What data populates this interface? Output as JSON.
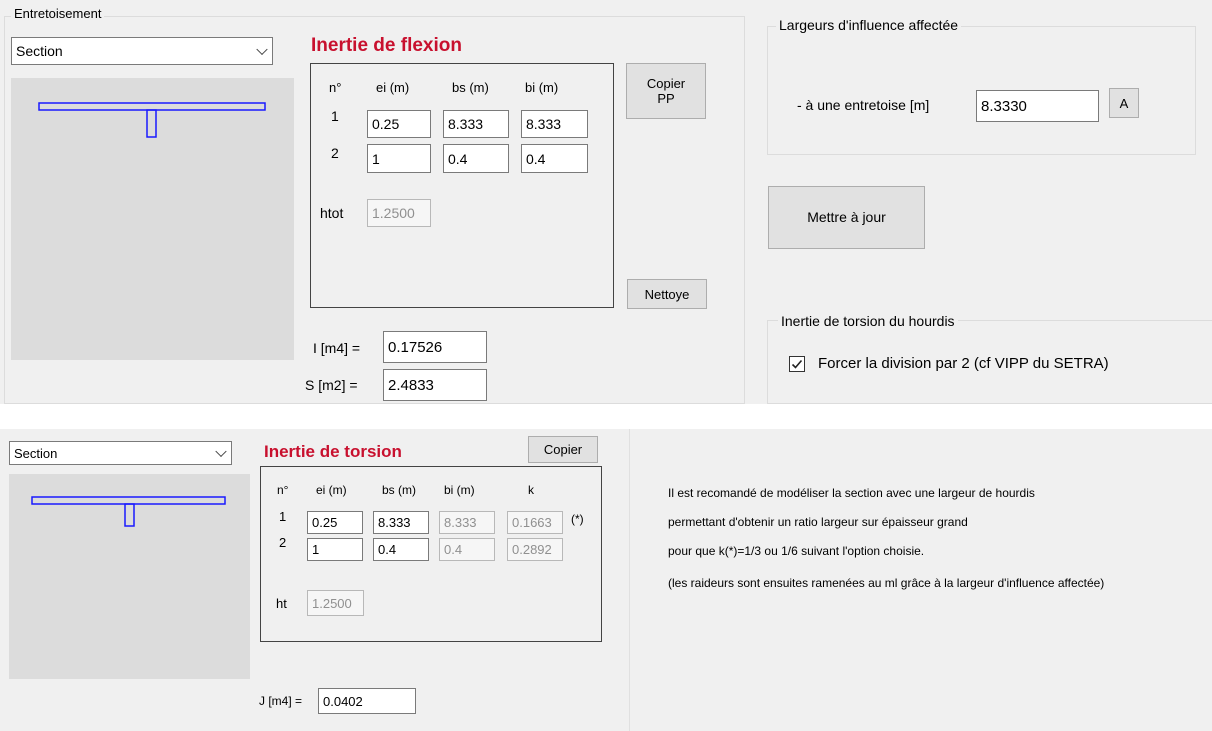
{
  "top": {
    "group_label": "Entretoisement",
    "section_select": {
      "value": "Section"
    },
    "flexion": {
      "title": "Inertie de flexion",
      "headers": [
        "n°",
        "ei (m)",
        "bs (m)",
        "bi (m)"
      ],
      "rows": [
        {
          "n": "1",
          "ei": "0.25",
          "bs": "8.333",
          "bi": "8.333"
        },
        {
          "n": "2",
          "ei": "1",
          "bs": "0.4",
          "bi": "0.4"
        }
      ],
      "htot_label": "htot",
      "htot_value": "1.2500",
      "copy_button": "Copier\nPP",
      "clean_button": "Nettoye",
      "inertia_label": "I [m4] =",
      "inertia_value": "0.17526",
      "area_label": "S [m2] =",
      "area_value": "2.4833"
    },
    "influence": {
      "group_label": "Largeurs d'influence affectée",
      "field_label": "- à une entretoise [m]",
      "field_value": "8.3330",
      "a_button": "A"
    },
    "update_button": "Mettre à jour",
    "torsion_group": {
      "label": "Inertie de torsion du hourdis",
      "checkbox_label": "Forcer la division par 2 (cf VIPP du SETRA)",
      "checked": true
    }
  },
  "bottom": {
    "section_select": {
      "value": "Section"
    },
    "torsion": {
      "title": "Inertie de torsion",
      "copy_button": "Copier",
      "headers": [
        "n°",
        "ei (m)",
        "bs (m)",
        "bi (m)",
        "k"
      ],
      "rows": [
        {
          "n": "1",
          "ei": "0.25",
          "bs": "8.333",
          "bi": "8.333",
          "k": "0.1663",
          "note": "(*)"
        },
        {
          "n": "2",
          "ei": "1",
          "bs": "0.4",
          "bi": "0.4",
          "k": "0.2892",
          "note": ""
        }
      ],
      "ht_label": "ht",
      "ht_value": "1.2500",
      "j_label": "J [m4] =",
      "j_value": "0.0402"
    },
    "notes": [
      "Il est recomandé de modéliser la section  avec une largeur de hourdis",
      "permettant d'obtenir un ratio largeur sur épaisseur grand",
      "pour que k(*)=1/3 ou 1/6 suivant l'option choisie.",
      "(les raideurs sont ensuites ramenées au ml grâce à la largeur d'influence affectée)"
    ]
  },
  "colors": {
    "title": "#c8102e",
    "section_outline": "#1a1aff",
    "panel": "#f0f0f0"
  }
}
